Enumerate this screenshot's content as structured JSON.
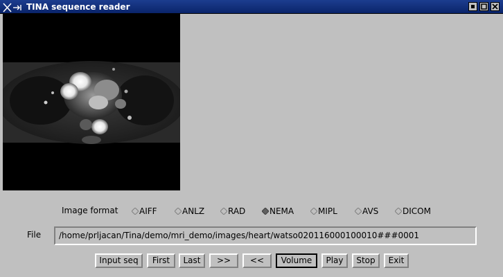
{
  "window": {
    "title": "TINA sequence reader"
  },
  "format": {
    "label": "Image format",
    "selected": "NEMA",
    "options": [
      {
        "label": "AIFF"
      },
      {
        "label": "ANLZ"
      },
      {
        "label": "RAD"
      },
      {
        "label": "NEMA"
      },
      {
        "label": "MIPL"
      },
      {
        "label": "AVS"
      },
      {
        "label": "DICOM"
      }
    ]
  },
  "file": {
    "label": "File",
    "value": "/home/prljacan/Tina/demo/mri_demo/images/heart/watso020116000100010###0001"
  },
  "buttons": {
    "input_seq": "Input seq",
    "first": "First",
    "last": "Last",
    "forward": ">>",
    "back": "<<",
    "volume": "Volume",
    "play": "Play",
    "stop": "Stop",
    "exit": "Exit"
  },
  "colors": {
    "title_bar": "#0a246a",
    "panel": "#c0c0c0",
    "image_bg": "#000000"
  }
}
